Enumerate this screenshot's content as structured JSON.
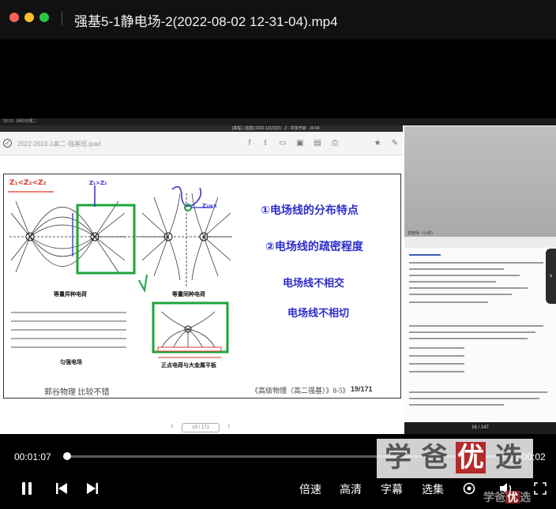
{
  "window": {
    "title": "强基5-1静电场-2(2022-08-02 12-31-04).mp4",
    "buttons": [
      "close",
      "minimize",
      "maximize"
    ]
  },
  "video": {
    "ipad_status": "10:13 · 8月2日周二",
    "doc_title_bar": "2022-2023-1高二-强基班.ipad",
    "top_center_text": "[章程二强基]  2022-12(2022) · 2  ·  共享开启 · 26:04",
    "slide": {
      "question_label": "Z₁<Z₂<Z₂",
      "figures": [
        "等量异种电荷",
        "等量同种电荷",
        "匀强电场",
        "正点电荷与大金属平板"
      ],
      "handwriting": [
        "①电场线的分布特点",
        "②电场线的疏密程度",
        "电场线不相交",
        "电场线不相切"
      ],
      "annotation_x": "Z₂=x",
      "annotation_top": "Z₁>Z₂",
      "footer_left": "郭谷物理  比较不错",
      "footer_right": "《高级物理（高二强基）》8-5》",
      "page_number": "19/171"
    },
    "pager": "19 / 171",
    "side_panel": {
      "camera_name": "郭老师（小讲）",
      "page": "16 / 147"
    }
  },
  "controls": {
    "current_time": "00:01:07",
    "total_time": "02:00:02",
    "progress": 0.009,
    "labels": {
      "speed": "倍速",
      "quality": "高清",
      "subtitles": "字幕",
      "episodes": "选集"
    }
  },
  "watermark": {
    "chars": [
      "学",
      "爸",
      "优",
      "选"
    ],
    "small": "学爸优选"
  },
  "colors": {
    "accent_red": "#b52a2a",
    "green_box": "#1ea43a",
    "handwriting_blue": "#2e2dcc"
  }
}
